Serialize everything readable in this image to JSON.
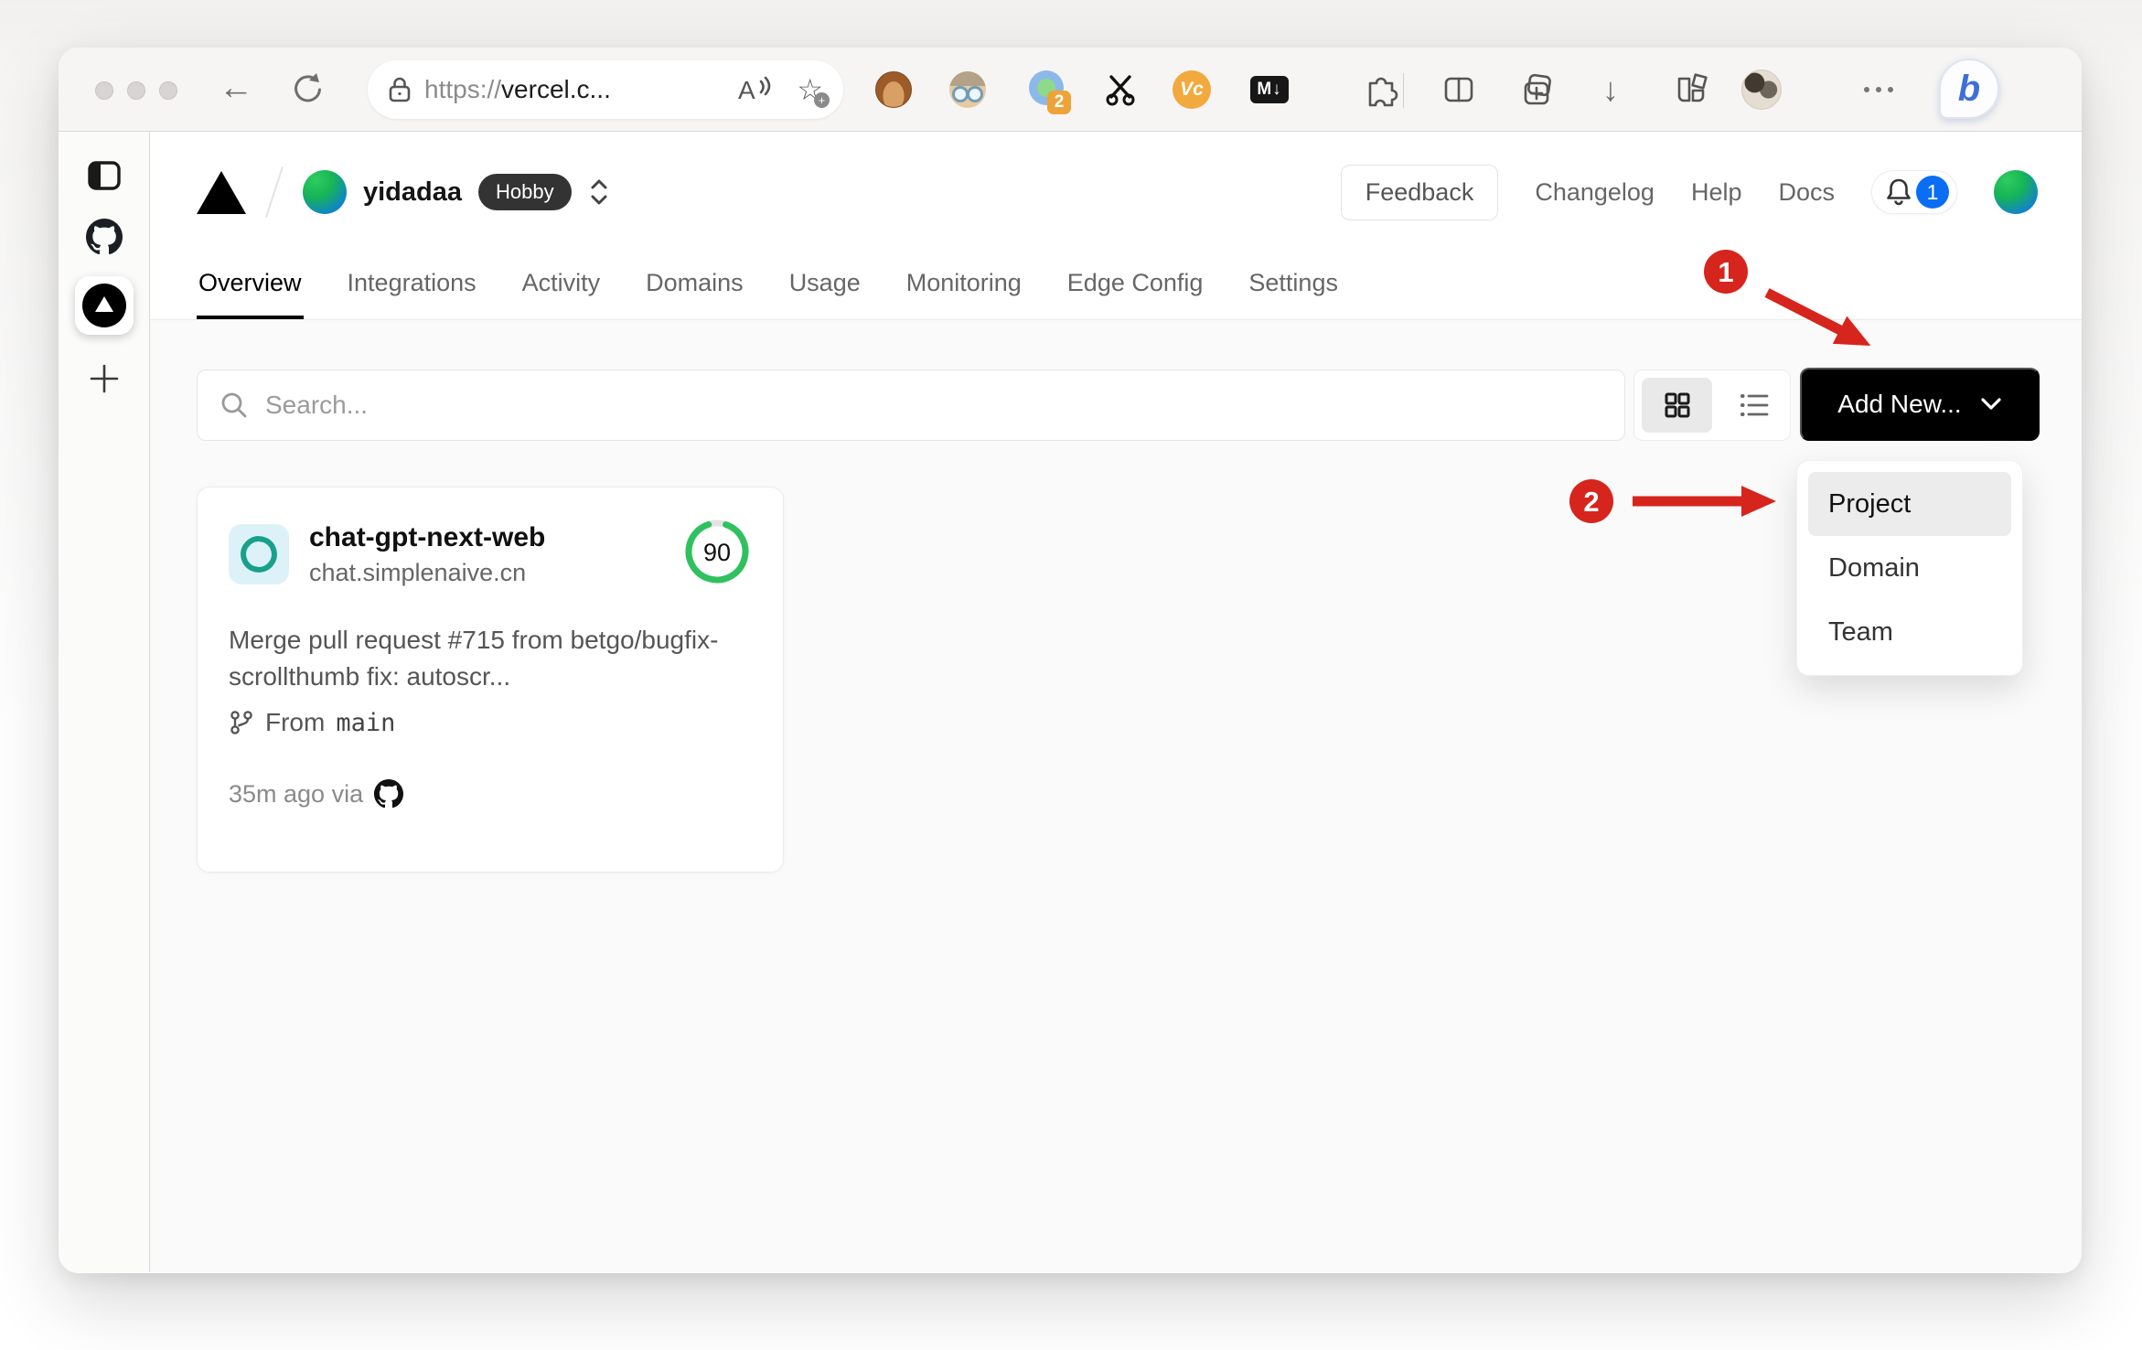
{
  "colors": {
    "annotation_red": "#d6251c",
    "score_green": "#2fc15e",
    "notification_blue": "#0a6ef4",
    "button_black": "#000000",
    "plan_badge_dark": "#333333"
  },
  "browser": {
    "url": {
      "scheme": "https://",
      "host": "vercel.c..."
    },
    "read_aloud_label": "A",
    "extensions": {
      "proxy_badge": "2",
      "video_label": "Vc",
      "markdown_label": "M↓"
    },
    "bing_label": "b"
  },
  "header": {
    "team_name": "yidadaa",
    "plan_badge": "Hobby",
    "feedback_label": "Feedback",
    "links": [
      {
        "label": "Changelog"
      },
      {
        "label": "Help"
      },
      {
        "label": "Docs"
      }
    ],
    "notification_count": "1"
  },
  "tabs": [
    {
      "label": "Overview"
    },
    {
      "label": "Integrations"
    },
    {
      "label": "Activity"
    },
    {
      "label": "Domains"
    },
    {
      "label": "Usage"
    },
    {
      "label": "Monitoring"
    },
    {
      "label": "Edge Config"
    },
    {
      "label": "Settings"
    }
  ],
  "content": {
    "search_placeholder": "Search...",
    "add_new_label": "Add New...",
    "dropdown": {
      "items": [
        {
          "label": "Project"
        },
        {
          "label": "Domain"
        },
        {
          "label": "Team"
        }
      ]
    },
    "project_card": {
      "name": "chat-gpt-next-web",
      "domain": "chat.simplenaive.cn",
      "score": "90",
      "commit_message": "Merge pull request #715 from betgo/bugfix-scrollthumb fix: autoscr...",
      "branch_label": "From",
      "branch_name": "main",
      "deployed_label": "35m ago via"
    },
    "annotations": [
      {
        "label": "1"
      },
      {
        "label": "2"
      }
    ]
  }
}
